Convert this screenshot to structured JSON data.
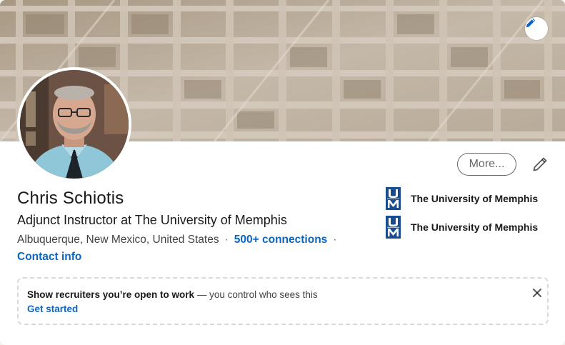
{
  "profile": {
    "name": "Chris Schiotis",
    "headline": "Adjunct Instructor at The University of Memphis",
    "location": "Albuquerque, New Mexico, United States",
    "separator": "·",
    "connections": "500+ connections",
    "contact_info": "Contact info"
  },
  "actions": {
    "more_label": "More...",
    "cover_edit_icon": "pencil-icon",
    "profile_edit_icon": "pencil-icon"
  },
  "education": [
    {
      "label": "The University of Memphis",
      "logo_text": "UM"
    },
    {
      "label": "The University of Memphis",
      "logo_text": "UM"
    }
  ],
  "open_to_work": {
    "strong_text": "Show recruiters you’re open to work",
    "rest_text": " — you control who sees this",
    "cta": "Get started",
    "close_icon": "close-icon"
  },
  "colors": {
    "link_blue": "#0a66c2",
    "memphis_blue": "#1a4d8f",
    "cover_tone": "#b8ab9a"
  }
}
